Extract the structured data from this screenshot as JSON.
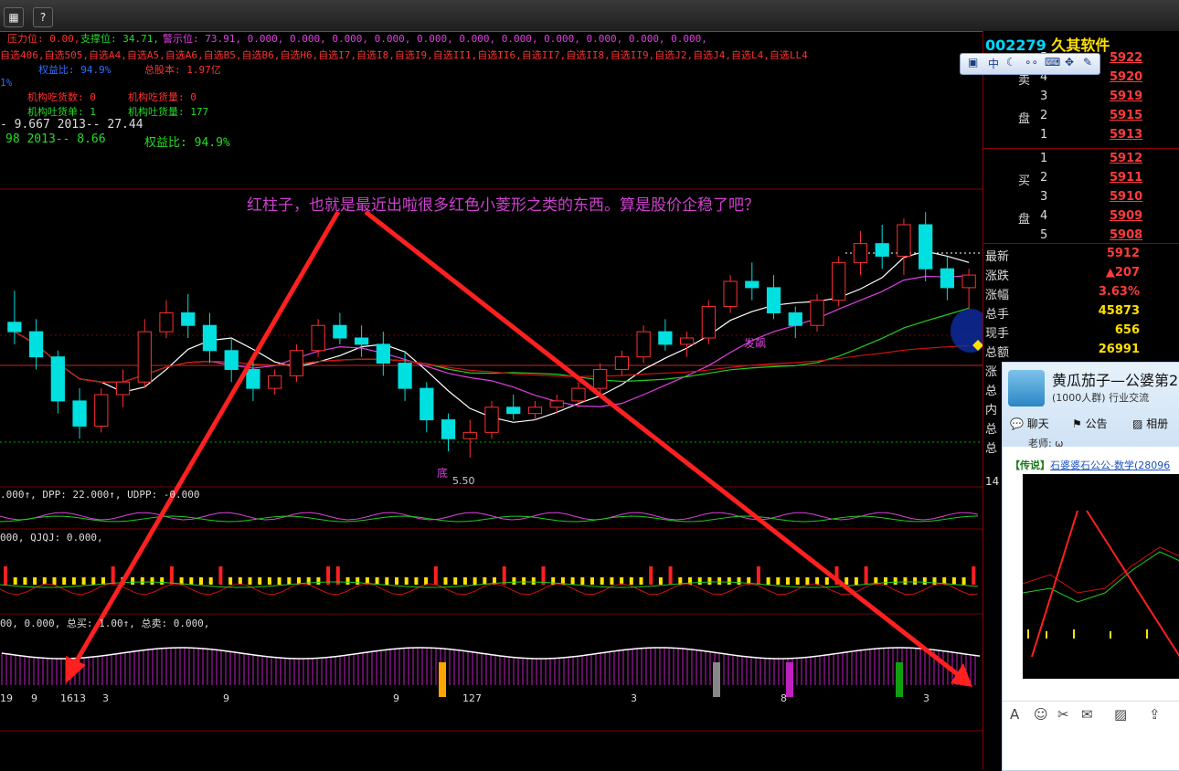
{
  "toolbar": {
    "icon1": "chart-icon",
    "icon2": "help-icon",
    "help_glyph": "?"
  },
  "info_lines": {
    "l1a": "压力位: 0.00,",
    "l1b": "支撑位: 34.71,",
    "l1c": "警示位: 73.91, 0.000, 0.000, 0.000, 0.000, 0.000, 0.000, 0.000, 0.000, 0.000, 0.000, 0.000,",
    "l2": "自选406,自选505,自选A4,自选A5,自选A6,自选B5,自选B6,自选H6,自选I7,自选I8,自选I9,自选II1,自选II6,自选II7,自选II8,自选II9,自选J2,自选J4,自选L4,自选LL4",
    "l3a": "权益比: 94.9%",
    "l3b": "总股本: 1.97亿",
    "l4": "1%",
    "l5a": "机构吃货数: 0",
    "l5b": "机构吃货量: 0",
    "l6a": "机构吐货单: 1",
    "l6b": "机构吐货量: 177",
    "l7": "- 9.667   2013-- 27.44",
    "l8a": "98   2013-- 8.66",
    "l8b": "权益比: 94.9%"
  },
  "annotation": "红柱子，也就是最近出啦很多红色小菱形之类的东西。算是股价企稳了吧？",
  "indicator_labels": {
    "dpp": ".000↑, DPP: 22.000↑, UDPP: -0.000",
    "qjqj": "000, QJQJ: 0.000,",
    "buy_sell": "00, 0.000, 总买: 1.00↑, 总卖: 0.000,"
  },
  "chart_texts": {
    "low_label": "5.50",
    "fa_biao": "发飙",
    "di": "底",
    "bottom_nums": [
      "19",
      "9",
      "1613",
      "3",
      "9",
      "9",
      "127",
      "3",
      "8",
      "3"
    ]
  },
  "chart_data": {
    "type": "candlestick",
    "title": "",
    "series": [
      {
        "name": "price",
        "candles": [
          [
            5.95,
            6.05,
            5.88,
            5.92
          ],
          [
            5.92,
            5.96,
            5.8,
            5.84
          ],
          [
            5.84,
            5.86,
            5.66,
            5.7
          ],
          [
            5.7,
            5.74,
            5.58,
            5.62
          ],
          [
            5.62,
            5.74,
            5.6,
            5.72
          ],
          [
            5.72,
            5.8,
            5.68,
            5.76
          ],
          [
            5.76,
            5.96,
            5.74,
            5.92
          ],
          [
            5.92,
            6.02,
            5.9,
            5.98
          ],
          [
            5.98,
            6.04,
            5.9,
            5.94
          ],
          [
            5.94,
            5.98,
            5.82,
            5.86
          ],
          [
            5.86,
            5.9,
            5.76,
            5.8
          ],
          [
            5.8,
            5.84,
            5.7,
            5.74
          ],
          [
            5.74,
            5.8,
            5.72,
            5.78
          ],
          [
            5.78,
            5.88,
            5.76,
            5.86
          ],
          [
            5.86,
            5.96,
            5.84,
            5.94
          ],
          [
            5.94,
            5.98,
            5.88,
            5.9
          ],
          [
            5.9,
            5.94,
            5.84,
            5.88
          ],
          [
            5.88,
            5.92,
            5.78,
            5.82
          ],
          [
            5.82,
            5.86,
            5.7,
            5.74
          ],
          [
            5.74,
            5.76,
            5.6,
            5.64
          ],
          [
            5.64,
            5.66,
            5.54,
            5.58
          ],
          [
            5.58,
            5.64,
            5.52,
            5.6
          ],
          [
            5.6,
            5.7,
            5.58,
            5.68
          ],
          [
            5.68,
            5.72,
            5.64,
            5.66
          ],
          [
            5.66,
            5.7,
            5.64,
            5.68
          ],
          [
            5.68,
            5.72,
            5.66,
            5.7
          ],
          [
            5.7,
            5.76,
            5.68,
            5.74
          ],
          [
            5.74,
            5.82,
            5.72,
            5.8
          ],
          [
            5.8,
            5.86,
            5.78,
            5.84
          ],
          [
            5.84,
            5.94,
            5.82,
            5.92
          ],
          [
            5.92,
            5.96,
            5.86,
            5.88
          ],
          [
            5.88,
            5.92,
            5.84,
            5.9
          ],
          [
            5.9,
            6.02,
            5.88,
            6.0
          ],
          [
            6.0,
            6.1,
            5.98,
            6.08
          ],
          [
            6.08,
            6.14,
            6.02,
            6.06
          ],
          [
            6.06,
            6.1,
            5.96,
            5.98
          ],
          [
            5.98,
            6.0,
            5.9,
            5.94
          ],
          [
            5.94,
            6.04,
            5.92,
            6.02
          ],
          [
            6.02,
            6.16,
            6.0,
            6.14
          ],
          [
            6.14,
            6.24,
            6.1,
            6.2
          ],
          [
            6.2,
            6.26,
            6.12,
            6.16
          ],
          [
            6.16,
            6.28,
            6.1,
            6.26
          ],
          [
            6.26,
            6.3,
            6.08,
            6.12
          ],
          [
            6.12,
            6.16,
            6.02,
            6.06
          ],
          [
            6.06,
            6.12,
            5.99,
            6.1
          ]
        ]
      },
      {
        "name": "MA5",
        "color": "#ffffff"
      },
      {
        "name": "MA10",
        "color": "#e040e0"
      },
      {
        "name": "MA20",
        "color": "#22cc22"
      },
      {
        "name": "MA60",
        "color": "#d01010"
      }
    ],
    "y_range": [
      5.45,
      6.35
    ],
    "x_range": [
      0,
      44
    ]
  },
  "panel": {
    "code": "002279",
    "name": "久其软件",
    "order_book": [
      {
        "side": "",
        "lvl": "5",
        "price": "5922"
      },
      {
        "side": "卖",
        "lvl": "4",
        "price": "5920"
      },
      {
        "side": "",
        "lvl": "3",
        "price": "5919"
      },
      {
        "side": "盘",
        "lvl": "2",
        "price": "5915"
      },
      {
        "side": "",
        "lvl": "1",
        "price": "5913"
      },
      {
        "side": "",
        "lvl": "1",
        "price": "5912"
      },
      {
        "side": "买",
        "lvl": "2",
        "price": "5911"
      },
      {
        "side": "",
        "lvl": "3",
        "price": "5910"
      },
      {
        "side": "盘",
        "lvl": "4",
        "price": "5909"
      },
      {
        "side": "",
        "lvl": "5",
        "price": "5908"
      }
    ],
    "quotes": [
      {
        "label": "最新",
        "value": "5912",
        "color": "#ff3b3b"
      },
      {
        "label": "涨跌",
        "value": "▲207",
        "color": "#ff3b3b"
      },
      {
        "label": "涨幅",
        "value": "3.63%",
        "color": "#ff3b3b"
      },
      {
        "label": "总手",
        "value": "45873",
        "color": "#ffe000"
      },
      {
        "label": "现手",
        "value": "656",
        "color": "#ffe000"
      },
      {
        "label": "总额",
        "value": "26991",
        "color": "#ffe000"
      }
    ],
    "more_labels": [
      "涨",
      "总",
      "内",
      "总",
      "总"
    ],
    "side_num": "14"
  },
  "qq": {
    "group_name": "黄瓜茄子—公婆第2",
    "group_sub": "(1000人群) 行业交流",
    "tab_chat": "聊天",
    "tab_notice": "公告",
    "tab_album": "相册",
    "prev_line": "老师: ω",
    "msg_tag": "【传说】",
    "msg_sender": "石婆婆石公公-数学",
    "msg_id": "(28096"
  }
}
